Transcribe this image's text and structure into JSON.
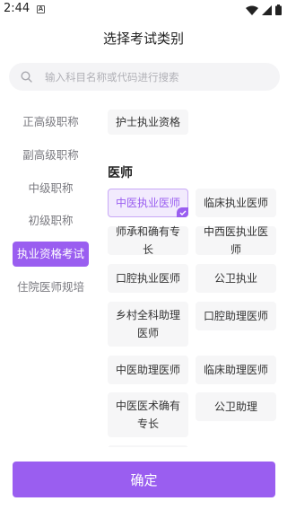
{
  "status_bar": {
    "time": "2:44",
    "notification_icon": "A"
  },
  "header": {
    "title": "选择考试类别"
  },
  "search": {
    "placeholder": "输入科目名称或代码进行搜索"
  },
  "sidebar": {
    "items": [
      {
        "label": "正高级职称"
      },
      {
        "label": "副高级职称"
      },
      {
        "label": "中级职称"
      },
      {
        "label": "初级职称"
      },
      {
        "label": "执业资格考试",
        "active": true
      },
      {
        "label": "住院医师规培"
      }
    ]
  },
  "content": {
    "top_option": "护士执业资格",
    "section_title": "医师",
    "options": [
      {
        "label": "中医执业医师",
        "selected": true
      },
      {
        "label": "临床执业医师"
      },
      {
        "label": "师承和确有专长"
      },
      {
        "label": "中西医执业医师"
      },
      {
        "label": "口腔执业医师"
      },
      {
        "label": "公卫执业"
      },
      {
        "label": "乡村全科助理医师"
      },
      {
        "label": "口腔助理医师"
      },
      {
        "label": "中医助理医师"
      },
      {
        "label": "临床助理医师"
      },
      {
        "label": "中医医术确有专长"
      },
      {
        "label": "公卫助理"
      }
    ]
  },
  "footer": {
    "confirm_label": "确定"
  },
  "colors": {
    "accent": "#9a5ef0",
    "selected_bg": "#f2ebfd"
  }
}
